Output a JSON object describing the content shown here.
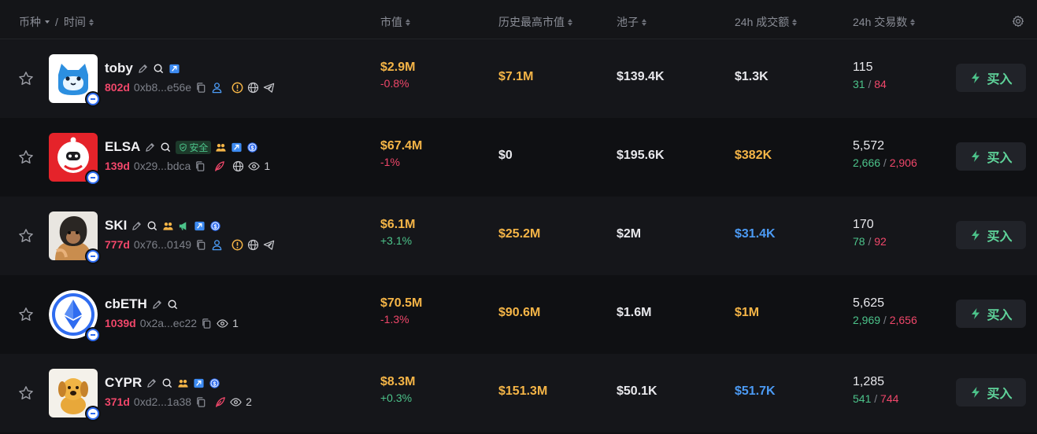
{
  "header": {
    "coin_time_label": "币种",
    "slash": "/",
    "time_label": "时间",
    "mcap_label": "市值",
    "ath_label": "历史最高市值",
    "pool_label": "池子",
    "volume_label": "24h 成交额",
    "txs_label": "24h 交易数",
    "settings_icon": "gear-icon"
  },
  "safe_label": "安全",
  "buy_label": "买入",
  "colors": {
    "background": "#0f1013",
    "row_alt": "#15161a",
    "accent_orange": "#f5b547",
    "negative": "#f0476a",
    "positive": "#4cc38a",
    "blue": "#4c9bf5"
  },
  "rows": [
    {
      "name": "toby",
      "age": "802d",
      "address": "0xb8...e56e",
      "mcap": "$2.9M",
      "mcap_change": "-0.8%",
      "ath_mcap": "$7.1M",
      "pool": "$139.4K",
      "volume": "$1.3K",
      "txs": "115",
      "buys": "31",
      "sells": "84"
    },
    {
      "name": "ELSA",
      "age": "139d",
      "address": "0x29...bdca",
      "views": "1",
      "mcap": "$67.4M",
      "mcap_change": "-1%",
      "ath_mcap": "$0",
      "pool": "$195.6K",
      "volume": "$382K",
      "txs": "5,572",
      "buys": "2,666",
      "sells": "2,906"
    },
    {
      "name": "SKI",
      "age": "777d",
      "address": "0x76...0149",
      "mcap": "$6.1M",
      "mcap_change": "+3.1%",
      "ath_mcap": "$25.2M",
      "pool": "$2M",
      "volume": "$31.4K",
      "txs": "170",
      "buys": "78",
      "sells": "92"
    },
    {
      "name": "cbETH",
      "age": "1039d",
      "address": "0x2a...ec22",
      "views": "1",
      "mcap": "$70.5M",
      "mcap_change": "-1.3%",
      "ath_mcap": "$90.6M",
      "pool": "$1.6M",
      "volume": "$1M",
      "txs": "5,625",
      "buys": "2,969",
      "sells": "2,656"
    },
    {
      "name": "CYPR",
      "age": "371d",
      "address": "0xd2...1a38",
      "views": "2",
      "mcap": "$8.3M",
      "mcap_change": "+0.3%",
      "ath_mcap": "$151.3M",
      "pool": "$50.1K",
      "volume": "$51.7K",
      "txs": "1,285",
      "buys": "541",
      "sells": "744"
    }
  ]
}
